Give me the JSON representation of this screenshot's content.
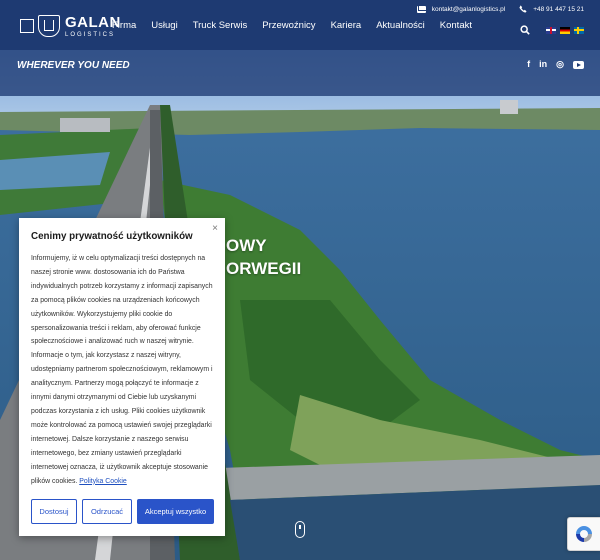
{
  "brand": {
    "name": "GALAN",
    "sub": "LOGISTICS"
  },
  "nav": [
    "Firma",
    "Usługi",
    "Truck Serwis",
    "Przewoźnicy",
    "Kariera",
    "Aktualności",
    "Kontakt"
  ],
  "contact": {
    "email": "kontakt@galanlogistics.pl",
    "phone": "+48 91 447 15 21"
  },
  "icons": {
    "mail": "mail-icon",
    "phone": "phone-icon",
    "search": "search-icon",
    "facebook": "facebook-icon",
    "linkedin": "linkedin-icon",
    "instagram": "instagram-icon",
    "youtube": "youtube-icon"
  },
  "tagline": "WHEREVER YOU NEED",
  "social": {
    "facebook": "f",
    "linkedin": "in",
    "instagram": "◎"
  },
  "hero": {
    "line1": "OWY",
    "line2": "ORWEGII"
  },
  "cookie": {
    "title": "Cenimy prywatność użytkowników",
    "close": "×",
    "body": "Informujemy, iż w celu optymalizacji treści dostępnych na naszej stronie www. dostosowania ich do Państwa indywidualnych potrzeb korzystamy z informacji zapisanych za pomocą plików cookies na urządzeniach końcowych użytkowników. Wykorzystujemy pliki cookie do spersonalizowania treści i reklam, aby oferować funkcje społecznościowe i analizować ruch w naszej witrynie. Informacje o tym, jak korzystasz z naszej witryny, udostępniamy partnerom społecznościowym, reklamowym i analitycznym. Partnerzy mogą połączyć te informacje z innymi danymi otrzymanymi od Ciebie lub uzyskanymi podczas korzystania z ich usług. Pliki cookies użytkownik może kontrolować za pomocą ustawień swojej przeglądarki internetowej. Dalsze korzystanie z naszego serwisu internetowego, bez zmiany ustawień przeglądarki internetowej oznacza, iż użytkownik akceptuje stosowanie plików cookies.",
    "link": "Polityka Cookie",
    "customize": "Dostosuj",
    "reject": "Odrzucać",
    "accept": "Akceptuj wszystko"
  },
  "colors": {
    "header": "#1e3a72",
    "accent": "#2a54c9",
    "water": "#3f6f9a",
    "land": "#4d8f3a"
  }
}
